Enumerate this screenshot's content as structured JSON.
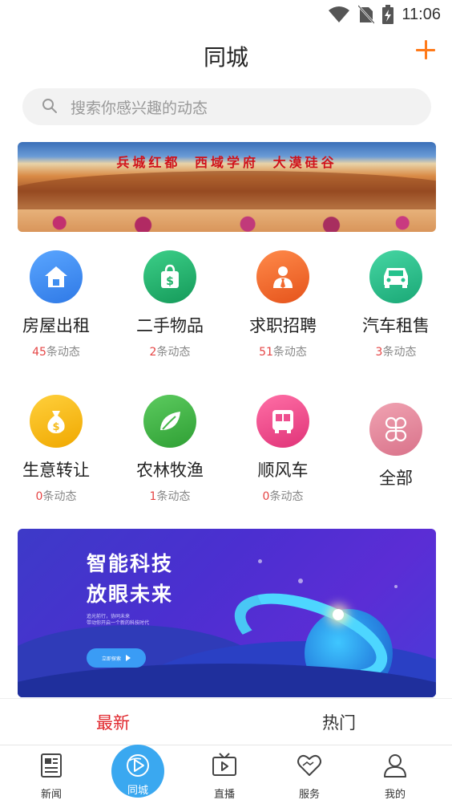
{
  "status_bar": {
    "time": "11:06"
  },
  "header": {
    "title": "同城"
  },
  "search": {
    "placeholder": "搜索你感兴趣的动态"
  },
  "banner_top": {
    "caption": "兵城红都 西域学府 大漠硅谷"
  },
  "categories": [
    {
      "label": "房屋出租",
      "count": "45",
      "count_suffix": "条动态",
      "icon": "house-icon",
      "color": "#3f8ef0"
    },
    {
      "label": "二手物品",
      "count": "2",
      "count_suffix": "条动态",
      "icon": "shopping-bag-icon",
      "color": "#22b36b"
    },
    {
      "label": "求职招聘",
      "count": "51",
      "count_suffix": "条动态",
      "icon": "person-tie-icon",
      "color": "#f26a2e"
    },
    {
      "label": "汽车租售",
      "count": "3",
      "count_suffix": "条动态",
      "icon": "car-icon",
      "color": "#25c28c"
    },
    {
      "label": "生意转让",
      "count": "0",
      "count_suffix": "条动态",
      "icon": "money-bag-icon",
      "color": "#f5bb1a"
    },
    {
      "label": "农林牧渔",
      "count": "1",
      "count_suffix": "条动态",
      "icon": "leaf-icon",
      "color": "#45b84a"
    },
    {
      "label": "顺风车",
      "count": "0",
      "count_suffix": "条动态",
      "icon": "bus-icon",
      "color": "#ee4f8f"
    },
    {
      "label": "全部",
      "icon": "clover-icon",
      "color": "#e3899d"
    }
  ],
  "banner_promo": {
    "title_line1": "智能科技",
    "title_line2": "放眼未来",
    "subtitle_line1": "追光前行，协同未来",
    "subtitle_line2": "带动你开启一个新的科技时代",
    "button_label": "立即探索"
  },
  "tabs": {
    "latest": "最新",
    "hot": "热门"
  },
  "bottom_nav": {
    "news": "新闻",
    "city": "同城",
    "live": "直播",
    "service": "服务",
    "mine": "我的"
  }
}
